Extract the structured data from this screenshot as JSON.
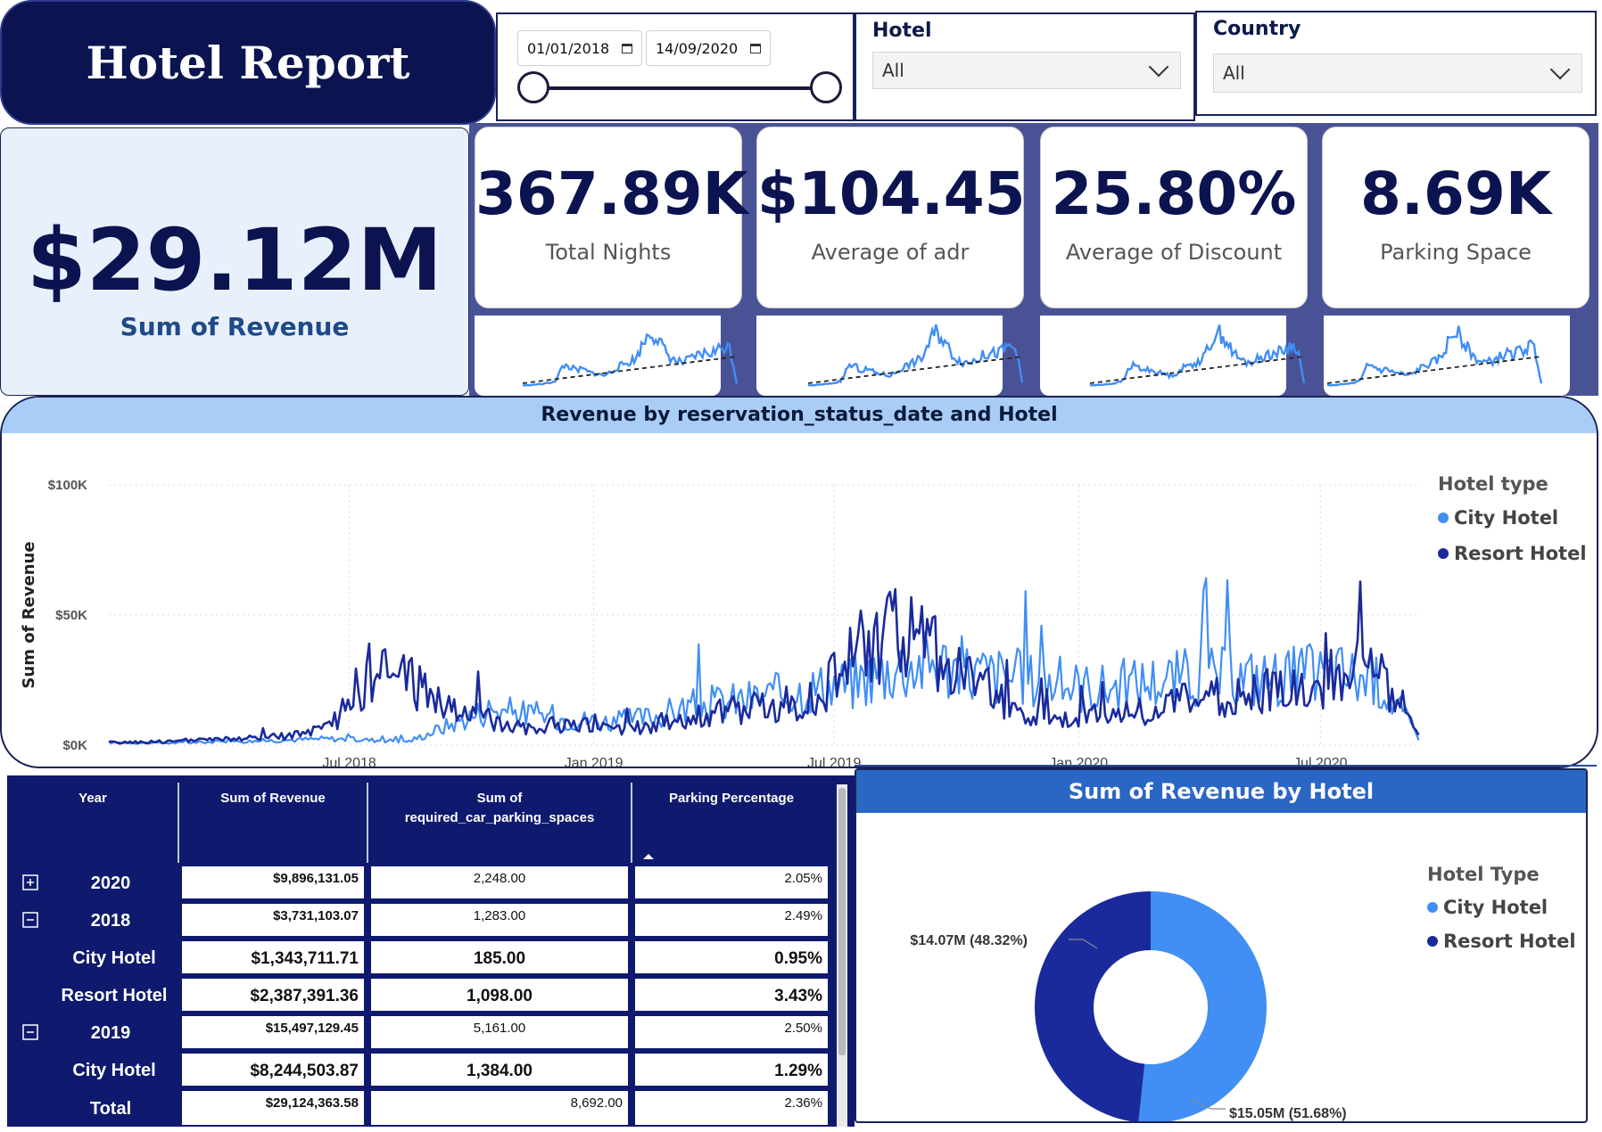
{
  "header": {
    "title": "Hotel Report"
  },
  "date_slicer": {
    "start": "01/01/2018",
    "end": "14/09/2020"
  },
  "hotel_slicer": {
    "label": "Hotel",
    "value": "All"
  },
  "country_slicer": {
    "label": "Country",
    "value": "All"
  },
  "revenue_card": {
    "value": "$29.12M",
    "label": "Sum of Revenue"
  },
  "kpis": [
    {
      "value": "367.89K",
      "label": "Total Nights"
    },
    {
      "value": "$104.45",
      "label": "Average of adr"
    },
    {
      "value": "25.80%",
      "label": "Average of Discount"
    },
    {
      "value": "8.69K",
      "label": "Parking Space"
    }
  ],
  "colors": {
    "city": "#418ef5",
    "resort": "#1a2a9c",
    "navy": "#0b1450",
    "trend": "#222222"
  },
  "chart_data": [
    {
      "type": "line",
      "title": "Revenue by reservation_status_date and Hotel",
      "xlabel": "reservation_status_date",
      "ylabel": "Sum of Revenue",
      "ylim": [
        0,
        100000
      ],
      "y_ticks": [
        "$0K",
        "$50K",
        "$100K"
      ],
      "x_ticks": [
        "Jul 2018",
        "Jan 2019",
        "Jul 2019",
        "Jan 2020",
        "Jul 2020"
      ],
      "x_range": [
        "2018-01-01",
        "2020-09-14"
      ],
      "grid": true,
      "legend": {
        "title": "Hotel type",
        "position": "right"
      },
      "series": [
        {
          "name": "City Hotel",
          "x": [
            "2018-01",
            "2018-02",
            "2018-03",
            "2018-04",
            "2018-05",
            "2018-06",
            "2018-07",
            "2018-08",
            "2018-09",
            "2018-10",
            "2018-11",
            "2018-12",
            "2019-01",
            "2019-02",
            "2019-03",
            "2019-04",
            "2019-05",
            "2019-06",
            "2019-07",
            "2019-08",
            "2019-09",
            "2019-10",
            "2019-11",
            "2019-12",
            "2020-01",
            "2020-02",
            "2020-03",
            "2020-04",
            "2020-05",
            "2020-06",
            "2020-07",
            "2020-08",
            "2020-09"
          ],
          "values": [
            1000,
            800,
            1200,
            1500,
            2000,
            2500,
            2000,
            1500,
            8000,
            14000,
            12000,
            10000,
            9000,
            11000,
            15000,
            17000,
            19000,
            22000,
            24000,
            30000,
            32000,
            28000,
            26000,
            24000,
            22000,
            24000,
            26000,
            27000,
            26000,
            27000,
            28000,
            24000,
            2000
          ]
        },
        {
          "name": "Resort Hotel",
          "x": [
            "2018-01",
            "2018-02",
            "2018-03",
            "2018-04",
            "2018-05",
            "2018-06",
            "2018-07",
            "2018-08",
            "2018-09",
            "2018-10",
            "2018-11",
            "2018-12",
            "2019-01",
            "2019-02",
            "2019-03",
            "2019-04",
            "2019-05",
            "2019-06",
            "2019-07",
            "2019-08",
            "2019-09",
            "2019-10",
            "2019-11",
            "2019-12",
            "2020-01",
            "2020-02",
            "2020-03",
            "2020-04",
            "2020-05",
            "2020-06",
            "2020-07",
            "2020-08",
            "2020-09"
          ],
          "values": [
            1000,
            1500,
            2000,
            2500,
            3500,
            6000,
            27000,
            26000,
            14000,
            10000,
            7000,
            8000,
            6000,
            8000,
            11000,
            13000,
            15000,
            17000,
            35000,
            45000,
            36000,
            24000,
            14000,
            10000,
            11000,
            13000,
            16000,
            18000,
            20000,
            22000,
            27000,
            29000,
            3000
          ]
        }
      ]
    },
    {
      "type": "pie",
      "title": "Sum of Revenue by Hotel",
      "legend": {
        "title": "Hotel Type",
        "position": "right"
      },
      "categories": [
        "City Hotel",
        "Resort Hotel"
      ],
      "values": [
        15.05,
        14.07
      ],
      "unit": "M",
      "data_labels": [
        "$15.05M (51.68%)",
        "$14.07M (48.32%)"
      ]
    },
    {
      "type": "table",
      "columns": [
        "Year",
        "Sum of Revenue",
        "Sum of required_car_parking_spaces",
        "Parking Percentage"
      ],
      "rows": [
        {
          "year": "2020",
          "revenue": "$9,896,131.05",
          "parking": "2,248.00",
          "pct": "2.05%",
          "kind": "group",
          "expander": "plus"
        },
        {
          "year": "2018",
          "revenue": "$3,731,103.07",
          "parking": "1,283.00",
          "pct": "2.49%",
          "kind": "group",
          "expander": "minus"
        },
        {
          "year": "City Hotel",
          "revenue": "$1,343,711.71",
          "parking": "185.00",
          "pct": "0.95%",
          "kind": "child"
        },
        {
          "year": "Resort Hotel",
          "revenue": "$2,387,391.36",
          "parking": "1,098.00",
          "pct": "3.43%",
          "kind": "child"
        },
        {
          "year": "2019",
          "revenue": "$15,497,129.45",
          "parking": "5,161.00",
          "pct": "2.50%",
          "kind": "group",
          "expander": "minus"
        },
        {
          "year": "City Hotel",
          "revenue": "$8,244,503.87",
          "parking": "1,384.00",
          "pct": "1.29%",
          "kind": "child"
        },
        {
          "year": "Total",
          "revenue": "$29,124,363.58",
          "parking": "8,692.00",
          "pct": "2.36%",
          "kind": "total"
        }
      ]
    }
  ]
}
